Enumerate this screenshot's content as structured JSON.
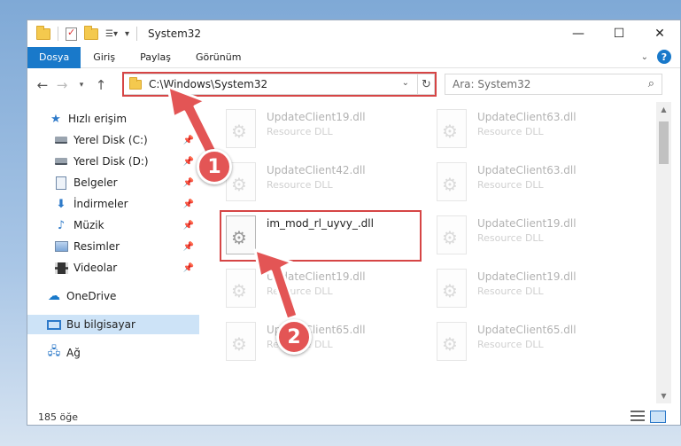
{
  "window": {
    "title": "System32",
    "controls": {
      "minimize": "—",
      "maximize": "☐",
      "close": "✕"
    }
  },
  "ribbon": {
    "tabs": [
      {
        "label": "Dosya",
        "active": true
      },
      {
        "label": "Giriş"
      },
      {
        "label": "Paylaş"
      },
      {
        "label": "Görünüm"
      }
    ],
    "help": "?"
  },
  "address": {
    "path": "C:\\Windows\\System32",
    "search_placeholder": "Ara: System32"
  },
  "sidebar": {
    "items": [
      {
        "label": "Hızlı erişim",
        "icon": "star-icon"
      },
      {
        "label": "Yerel Disk (C:)",
        "icon": "drive-icon",
        "pinned": true
      },
      {
        "label": "Yerel Disk (D:)",
        "icon": "drive-icon",
        "pinned": true
      },
      {
        "label": "Belgeler",
        "icon": "documents-icon",
        "pinned": true
      },
      {
        "label": "İndirmeler",
        "icon": "downloads-icon",
        "pinned": true
      },
      {
        "label": "Müzik",
        "icon": "music-icon",
        "pinned": true
      },
      {
        "label": "Resimler",
        "icon": "pictures-icon",
        "pinned": true
      },
      {
        "label": "Videolar",
        "icon": "videos-icon",
        "pinned": true
      },
      {
        "label": "OneDrive",
        "icon": "onedrive-icon"
      },
      {
        "label": "Bu bilgisayar",
        "icon": "computer-icon",
        "selected": true
      },
      {
        "label": "Ağ",
        "icon": "network-icon"
      }
    ]
  },
  "files": [
    {
      "name": "UpdateClient19.dll",
      "type": "Resource DLL"
    },
    {
      "name": "UpdateClient63.dll",
      "type": "Resource DLL"
    },
    {
      "name": "UpdateClient42.dll",
      "type": "Resource DLL"
    },
    {
      "name": "UpdateClient63.dll",
      "type": "Resource DLL"
    },
    {
      "name": "im_mod_rl_uyvy_.dll",
      "type": "",
      "highlighted": true
    },
    {
      "name": "UpdateClient19.dll",
      "type": "Resource DLL"
    },
    {
      "name": "UpdateClient19.dll",
      "type": "Resource DLL"
    },
    {
      "name": "UpdateClient19.dll",
      "type": "Resource DLL"
    },
    {
      "name": "UpdateClient65.dll",
      "type": "Resource DLL"
    },
    {
      "name": "UpdateClient65.dll",
      "type": "Resource DLL"
    }
  ],
  "status": {
    "item_count": "185 öğe"
  },
  "callouts": {
    "step1": "1",
    "step2": "2"
  },
  "colors": {
    "accent": "#1979ca",
    "highlight": "#d64545",
    "badge": "#e35555"
  }
}
